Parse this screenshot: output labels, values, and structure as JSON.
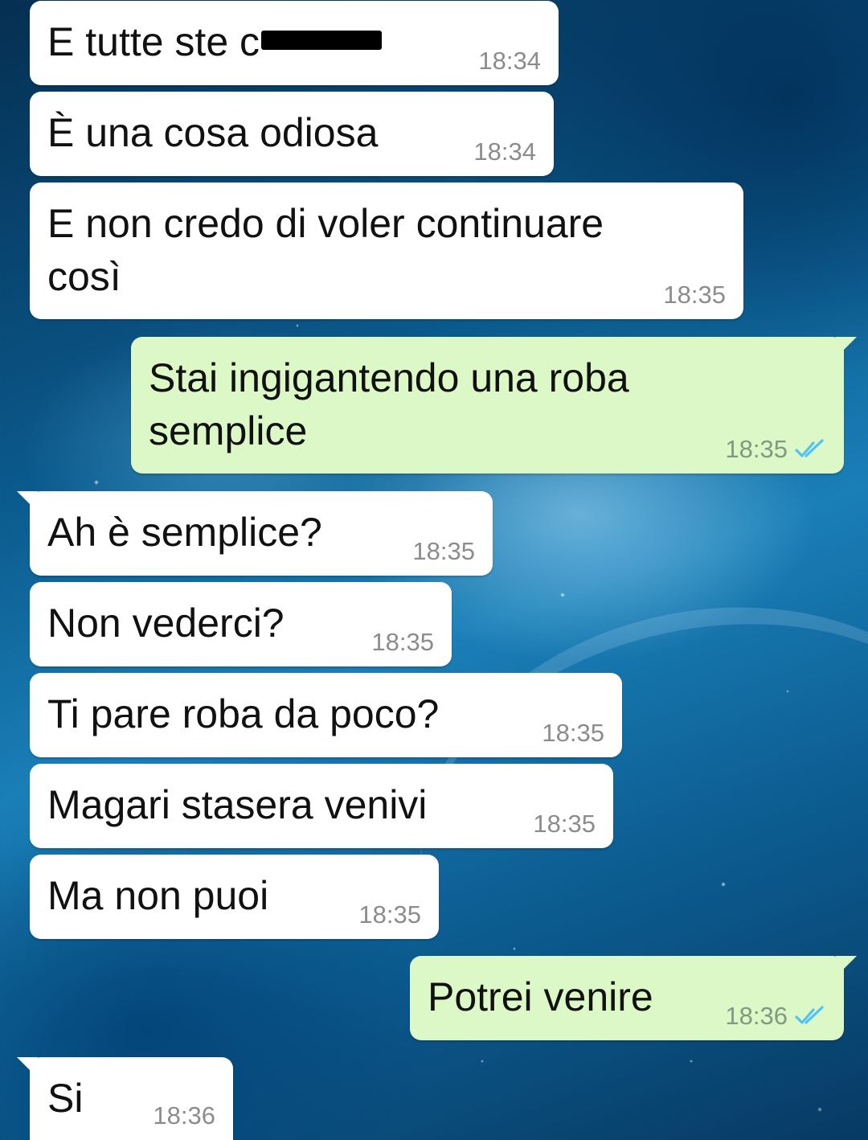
{
  "conversation": {
    "messages": [
      {
        "direction": "in",
        "text": "E tutte ste c",
        "redacted": true,
        "time": "18:34"
      },
      {
        "direction": "in",
        "text": "È una cosa odiosa",
        "time": "18:34"
      },
      {
        "direction": "in",
        "text": "E non credo di voler continuare\ncosì",
        "time": "18:35"
      },
      {
        "direction": "out",
        "text": "Stai ingigantendo una roba\nsemplice",
        "time": "18:35",
        "status": "double-check-read"
      },
      {
        "direction": "in",
        "text": "Ah è semplice?",
        "time": "18:35"
      },
      {
        "direction": "in",
        "text": "Non vederci?",
        "time": "18:35"
      },
      {
        "direction": "in",
        "text": "Ti pare roba da poco?",
        "time": "18:35"
      },
      {
        "direction": "in",
        "text": "Magari stasera venivi",
        "time": "18:35"
      },
      {
        "direction": "in",
        "text": "Ma non puoi",
        "time": "18:35"
      },
      {
        "direction": "out",
        "text": "Potrei venire",
        "time": "18:36",
        "status": "double-check-read"
      },
      {
        "direction": "in",
        "text": "Si",
        "time": "18:36"
      }
    ]
  },
  "colors": {
    "incoming_bubble": "#ffffff",
    "outgoing_bubble": "#dcf8c6",
    "read_tick": "#4fc3f7",
    "timestamp": "#8c8c8c"
  },
  "icons": {
    "read_status": "double-check-icon"
  }
}
